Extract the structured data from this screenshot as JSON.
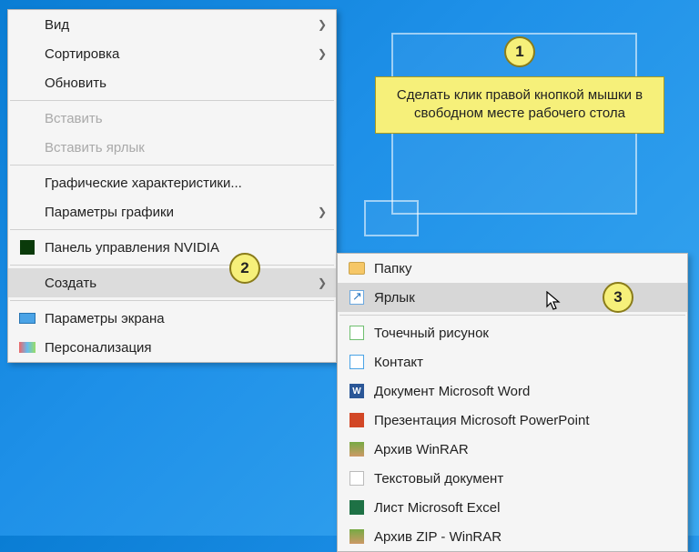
{
  "help": {
    "text": "Сделать клик правой кнопкой мышки в свободном месте рабочего стола"
  },
  "badges": {
    "one": "1",
    "two": "2",
    "three": "3"
  },
  "menu1": {
    "view": "Вид",
    "sort": "Сортировка",
    "refresh": "Обновить",
    "paste": "Вставить",
    "paste_shortcut": "Вставить ярлык",
    "graphics_chars": "Графические характеристики...",
    "graphics_params": "Параметры графики",
    "nvidia": "Панель управления NVIDIA",
    "create": "Создать",
    "display_settings": "Параметры экрана",
    "personalization": "Персонализация"
  },
  "menu2": {
    "folder": "Папку",
    "shortcut": "Ярлык",
    "bitmap": "Точечный рисунок",
    "contact": "Контакт",
    "word": "Документ Microsoft Word",
    "ppt": "Презентация Microsoft PowerPoint",
    "rar": "Архив WinRAR",
    "txt": "Текстовый документ",
    "xls": "Лист Microsoft Excel",
    "zip": "Архив ZIP - WinRAR"
  }
}
